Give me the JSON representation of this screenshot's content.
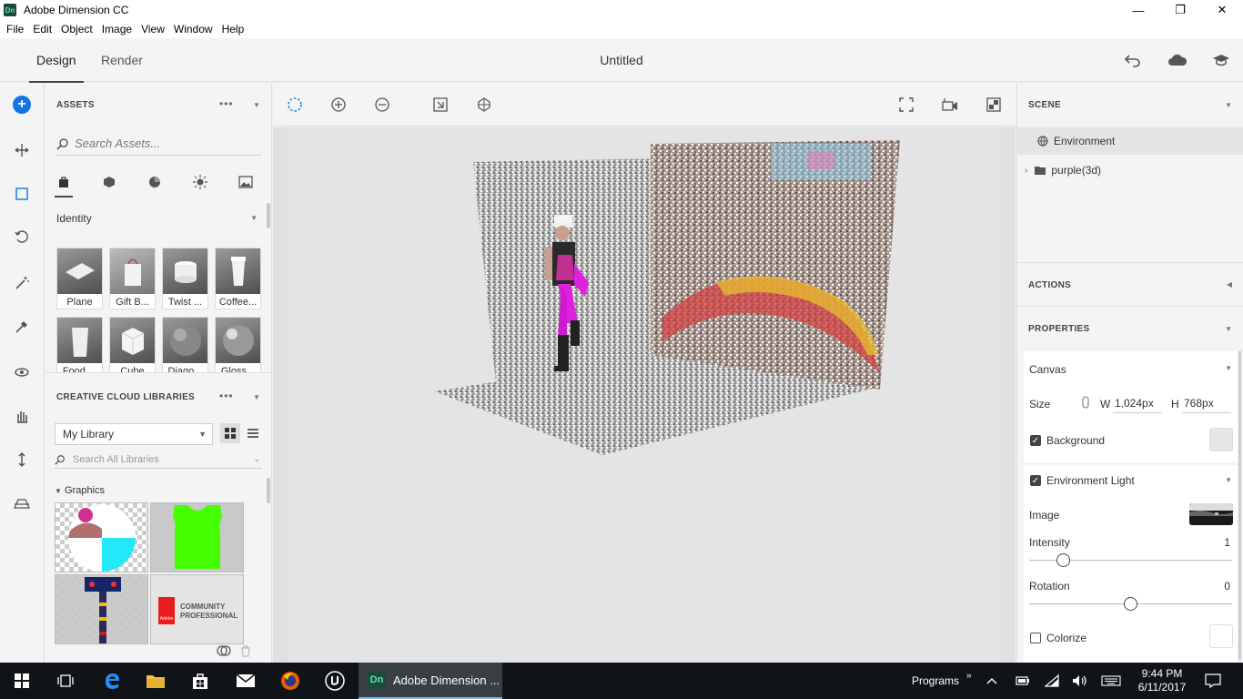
{
  "window": {
    "app_icon": "Dn",
    "title": "Adobe Dimension CC",
    "minimize": "—",
    "restore": "❐",
    "close": "✕"
  },
  "menu": [
    "File",
    "Edit",
    "Object",
    "Image",
    "View",
    "Window",
    "Help"
  ],
  "header": {
    "tabs": [
      "Design",
      "Render"
    ],
    "active_tab": "Design",
    "doc_title": "Untitled",
    "icons": [
      "undo-icon",
      "cloud-icon",
      "learn-icon"
    ]
  },
  "left_tools": [
    "add-icon",
    "move-icon",
    "select-icon",
    "rotate-icon",
    "magic-wand-icon",
    "eyedropper-icon",
    "orbit-icon",
    "pan-icon",
    "dolly-icon",
    "horizon-icon"
  ],
  "assets": {
    "header": "ASSETS",
    "more": "•••",
    "search_placeholder": "Search Assets...",
    "categories": [
      "bag-icon",
      "cube-icon",
      "material-icon",
      "light-icon",
      "image-icon"
    ],
    "filter": "Identity",
    "items": [
      {
        "label": "Plane"
      },
      {
        "label": "Gift B..."
      },
      {
        "label": "Twist ..."
      },
      {
        "label": "Coffee..."
      },
      {
        "label": "Food ..."
      },
      {
        "label": "Cube"
      },
      {
        "label": "Diago..."
      },
      {
        "label": "Gloss..."
      }
    ]
  },
  "libraries": {
    "header": "CREATIVE CLOUD LIBRARIES",
    "more": "•••",
    "selected_library": "My Library",
    "search_placeholder": "Search All Libraries",
    "section": "Graphics",
    "graphics": [
      "character-graphic",
      "green-tank-top-graphic",
      "hammer-graphic",
      "community-professional-badge"
    ],
    "badge_text": [
      "COMMUNITY",
      "PROFESSIONAL"
    ],
    "badge_logo": "Adobe"
  },
  "viewport_tools": {
    "left": [
      "marquee-select-icon",
      "add-selection-icon",
      "subtract-selection-icon",
      "select-similar-icon",
      "select-all-icon"
    ],
    "right": [
      "fit-view-icon",
      "camera-bookmark-icon",
      "render-preview-icon"
    ]
  },
  "scene": {
    "header": "SCENE",
    "items": [
      {
        "label": "Environment",
        "icon": "globe-icon"
      },
      {
        "label": "purple(3d)",
        "icon": "folder-icon"
      }
    ]
  },
  "actions": {
    "header": "ACTIONS"
  },
  "properties": {
    "header": "PROPERTIES",
    "canvas": {
      "title": "Canvas",
      "size_label": "Size",
      "w_label": "W",
      "w_value": "1,024px",
      "h_label": "H",
      "h_value": "768px",
      "background_label": "Background",
      "background_checked": true,
      "background_color": "#e6e6e6"
    },
    "environment_light": {
      "title": "Environment Light",
      "checked": true,
      "image_label": "Image",
      "intensity_label": "Intensity",
      "intensity_value": "1",
      "intensity_fraction": 0.17,
      "rotation_label": "Rotation",
      "rotation_value": "0",
      "rotation_fraction": 0.5,
      "colorize_label": "Colorize",
      "colorize_checked": false
    }
  },
  "taskbar": {
    "active_app": "Adobe Dimension ...",
    "active_app_icon": "Dn",
    "programs_label": "Programs",
    "time": "9:44 PM",
    "date": "6/11/2017"
  },
  "colors": {
    "accent": "#1473e6",
    "taskbar": "#101418"
  }
}
